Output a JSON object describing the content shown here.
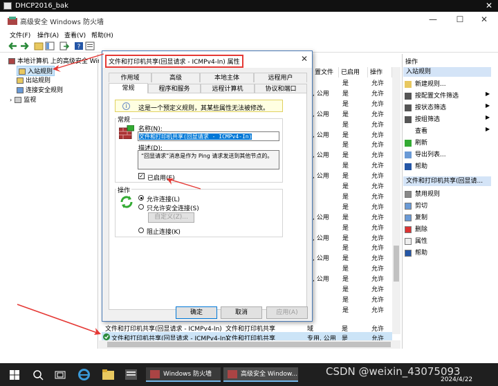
{
  "vm": {
    "title": "DHCP2016_bak",
    "close": "✕"
  },
  "window": {
    "title": "高级安全 Windows 防火墙",
    "minimize": "—",
    "maximize": "☐",
    "close": "✕"
  },
  "menu": [
    "文件(F)",
    "操作(A)",
    "查看(V)",
    "帮助(H)"
  ],
  "tree": {
    "root": "本地计算机 上的高级安全 Wind",
    "items": [
      "入站规则",
      "出站规则",
      "连接安全规则",
      "监视"
    ]
  },
  "list": {
    "headers": [
      "置文件",
      "已启用",
      "操作"
    ],
    "rows": [
      [
        "",
        "是",
        "允许"
      ],
      [
        ", 公用",
        "是",
        "允许"
      ],
      [
        "",
        "是",
        "允许"
      ],
      [
        ", 公用",
        "是",
        "允许"
      ],
      [
        "",
        "是",
        "允许"
      ],
      [
        ", 公用",
        "是",
        "允许"
      ],
      [
        "",
        "是",
        "允许"
      ],
      [
        ", 公用",
        "是",
        "允许"
      ],
      [
        "",
        "是",
        "允许"
      ],
      [
        ", 公用",
        "是",
        "允许"
      ],
      [
        "",
        "是",
        "允许"
      ],
      [
        "",
        "是",
        "允许"
      ],
      [
        "",
        "是",
        "允许"
      ],
      [
        ", 公用",
        "是",
        "允许"
      ],
      [
        "",
        "是",
        "允许"
      ],
      [
        ", 公用",
        "是",
        "允许"
      ],
      [
        "",
        "是",
        "允许"
      ],
      [
        ", 公用",
        "是",
        "允许"
      ],
      [
        "",
        "是",
        "允许"
      ],
      [
        ", 公用",
        "是",
        "允许"
      ],
      [
        "",
        "是",
        "允许"
      ],
      [
        "",
        "是",
        "允许"
      ],
      [
        "",
        "是",
        "允许"
      ]
    ],
    "bottom_rows": [
      {
        "name": "文件和打印机共享(回显请求 - ICMPv4-In)",
        "group": "文件和打印机共享",
        "profile": "域",
        "enabled": "是",
        "action": "允许"
      },
      {
        "name": "文件和打印机共享(回显请求 - ICMPv4-In)",
        "group": "文件和打印机共享",
        "profile": "专用, 公用",
        "enabled": "是",
        "action": "允许"
      }
    ]
  },
  "actions": {
    "header": "操作",
    "section1": "入站规则",
    "items1": [
      "新建规则...",
      "按配置文件筛选",
      "按状态筛选",
      "按组筛选",
      "查看",
      "刷新",
      "导出列表...",
      "帮助"
    ],
    "section2": "文件和打印机共享(回显请...",
    "items2": [
      "禁用规则",
      "剪切",
      "复制",
      "删除",
      "属性",
      "帮助"
    ]
  },
  "dialog": {
    "title": "文件和打印机共享(回显请求 - ICMPv4-In) 属性",
    "close": "✕",
    "tabs_row1": [
      "作用域",
      "高级",
      "本地主体",
      "远程用户"
    ],
    "tabs_row2": [
      "常规",
      "程序和服务",
      "远程计算机",
      "协议和端口"
    ],
    "info": "这是一个预定义规则，其某些属性无法被修改。",
    "general_label": "常规",
    "name_label": "名称(N):",
    "name_value": "文件和打印机共享(回显请求 - ICMPv4-In)",
    "desc_label": "描述(D):",
    "desc_value": "“回显请求”消息是作为 Ping 请求发送到其他节点的。",
    "enabled_label": "已启用(E)",
    "action_label": "操作",
    "allow": "允许连接(L)",
    "allow_secure": "只允许安全连接(S)",
    "customize": "自定义(Z)...",
    "block": "阻止连接(K)",
    "ok": "确定",
    "cancel": "取消",
    "apply": "应用(A)"
  },
  "taskbar": {
    "app1": "Windows 防火墙",
    "app2": "高级安全 Window...",
    "date": "2024/4/22",
    "watermark": "CSDN @weixin_43075093"
  },
  "colors": {
    "accent": "#0078d7",
    "section": "#d4e4f7",
    "annotation": "#e53935",
    "taskbar": "#1f1f1f"
  }
}
